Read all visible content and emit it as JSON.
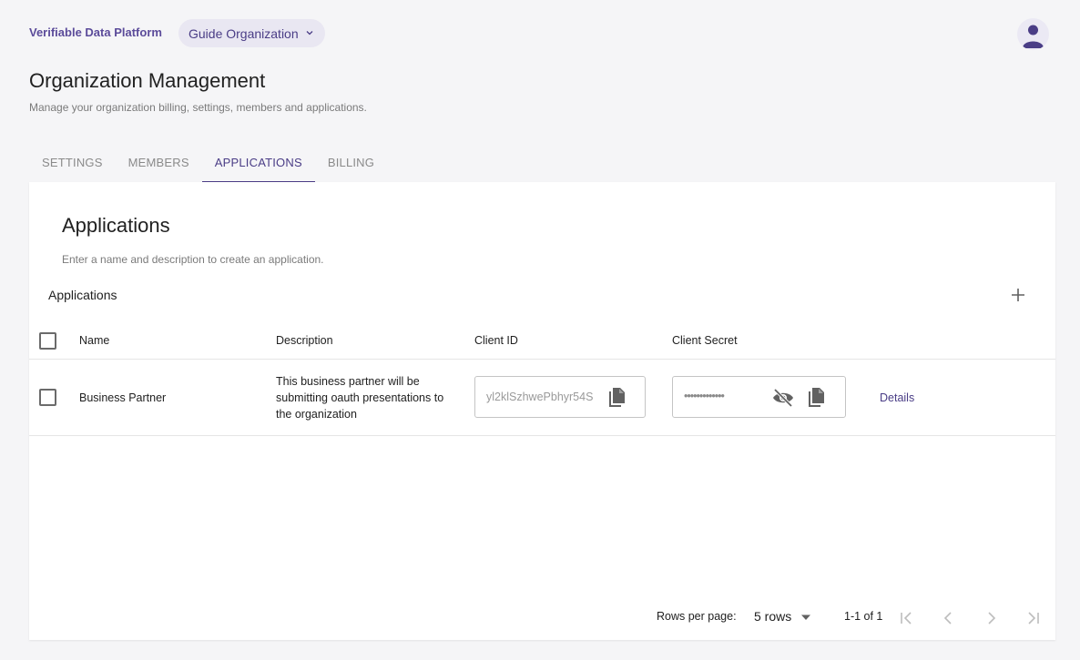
{
  "header": {
    "brand": "Verifiable Data Platform",
    "org_selector": "Guide Organization"
  },
  "page": {
    "title": "Organization Management",
    "subtitle": "Manage your organization billing, settings, members and applications."
  },
  "tabs": [
    {
      "label": "SETTINGS"
    },
    {
      "label": "MEMBERS"
    },
    {
      "label": "APPLICATIONS"
    },
    {
      "label": "BILLING"
    }
  ],
  "card": {
    "title": "Applications",
    "subtitle": "Enter a name and description to create an application.",
    "table_title": "Applications"
  },
  "table": {
    "columns": {
      "name": "Name",
      "description": "Description",
      "client_id": "Client ID",
      "client_secret": "Client Secret"
    },
    "rows": [
      {
        "name": "Business Partner",
        "description": "This business partner will be submitting oauth presentations to the organization",
        "client_id": "yl2klSzhwePbhyr54S",
        "client_secret": "•••••••••••••",
        "details_label": "Details"
      }
    ]
  },
  "pagination": {
    "rows_per_page_label": "Rows per page:",
    "rows_value": "5 rows",
    "range": "1-1 of 1"
  },
  "colors": {
    "accent": "#4a3d86",
    "brand": "#5b4b9a",
    "icon_gray": "#616161"
  }
}
